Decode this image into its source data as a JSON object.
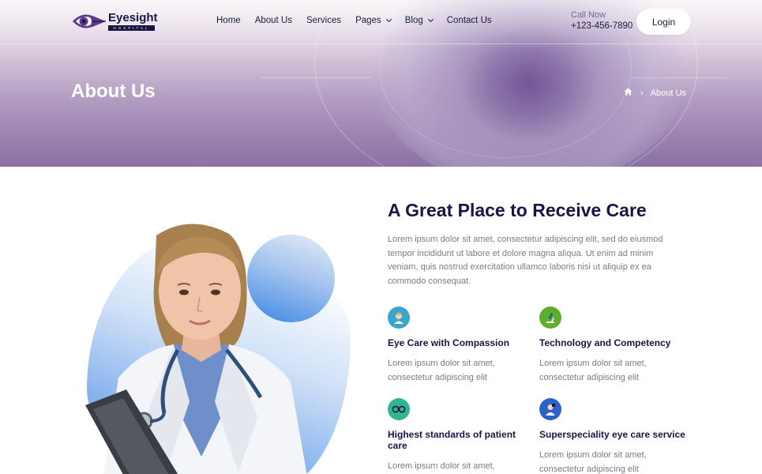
{
  "header": {
    "logo": {
      "name": "Eyesight",
      "sub": "HOSPITAL"
    },
    "nav": [
      {
        "label": "Home",
        "has_dropdown": false
      },
      {
        "label": "About Us",
        "has_dropdown": false
      },
      {
        "label": "Services",
        "has_dropdown": false
      },
      {
        "label": "Pages",
        "has_dropdown": true
      },
      {
        "label": "Blog",
        "has_dropdown": true
      },
      {
        "label": "Contact Us",
        "has_dropdown": false
      }
    ],
    "call_label": "Call Now",
    "call_number": "+123-456-7890",
    "login_label": "Login"
  },
  "hero": {
    "title": "About Us",
    "breadcrumb_current": "About Us",
    "breadcrumb_icon": "home-icon"
  },
  "about": {
    "heading": "A Great Place to Receive Care",
    "text": "Lorem ipsum dolor sit amet, consectetur adipiscing elit, sed do eiusmod tempor incididunt ut labore et dolore magna aliqua. Ut enim ad minim veniam, quis nostrud exercitation ullamco laboris nisi ut aliquip ex ea commodo consequat.",
    "features": [
      {
        "title": "Eye Care with Compassion",
        "text": "Lorem ipsum dolor sit amet, consectetur adipiscing elit",
        "icon": "nurse-icon",
        "color": "#3aa6cc"
      },
      {
        "title": "Technology and Competency",
        "text": "Lorem ipsum dolor sit amet, consectetur adipiscing elit",
        "icon": "microscope-icon",
        "color": "#5cae2c"
      },
      {
        "title": "Highest standards of patient care",
        "text": "Lorem ipsum dolor sit amet,",
        "icon": "glasses-icon",
        "color": "#2fb58f"
      },
      {
        "title": "Superspeciality eye care service",
        "text": "Lorem ipsum dolor sit amet, consectetur adipiscing elit",
        "icon": "doctor-icon",
        "color": "#2a62c8"
      }
    ]
  },
  "colors": {
    "brand_navy": "#1b1446",
    "accent_blue": "#3c86e4",
    "hero_purple": "#8e74a8"
  }
}
